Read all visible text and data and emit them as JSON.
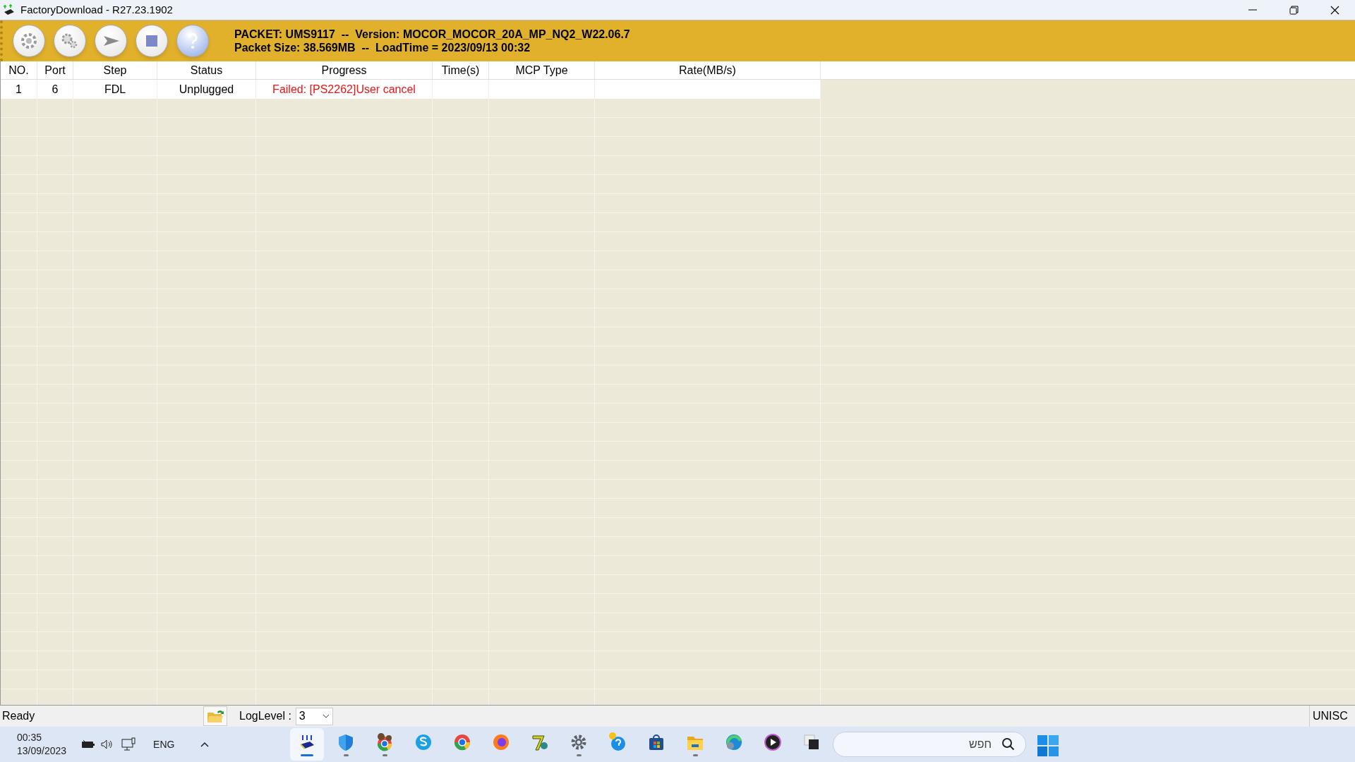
{
  "window": {
    "title": "FactoryDownload - R27.23.1902"
  },
  "toolbar": {
    "buttons": [
      {
        "kind": "settings"
      },
      {
        "kind": "advanced"
      },
      {
        "kind": "start"
      },
      {
        "kind": "stop"
      },
      {
        "kind": "help"
      }
    ],
    "packet_info": [
      "PACKET: UMS9117  --  Version: MOCOR_MOCOR_20A_MP_NQ2_W22.06.7",
      "Packet Size: 38.569MB  --  LoadTime = 2023/09/13 00:32"
    ]
  },
  "table": {
    "columns": [
      "NO.",
      "Port",
      "Step",
      "Status",
      "Progress",
      "Time(s)",
      "MCP Type",
      "Rate(MB/s)"
    ],
    "rows": [
      {
        "cells": [
          "1",
          "6",
          "FDL",
          "Unplugged",
          "Failed: [PS2262]User cancel",
          "",
          "",
          ""
        ],
        "failed": true
      }
    ]
  },
  "status_bar": {
    "text": "Ready",
    "log_level_label": "LogLevel :",
    "log_level": "3",
    "right_text": "UNISC"
  },
  "taskbar": {
    "time": "00:35",
    "date": "13/09/2023",
    "language": "ENG",
    "search_placeholder": "חפש",
    "apps": [
      {
        "kind": "download",
        "running": true,
        "active": true
      },
      {
        "kind": "shield",
        "running": true,
        "active": false
      },
      {
        "kind": "chrome-profile",
        "running": true,
        "active": false
      },
      {
        "kind": "skype",
        "running": false,
        "active": false
      },
      {
        "kind": "chrome",
        "running": false,
        "active": false
      },
      {
        "kind": "firefox",
        "running": false,
        "active": false
      },
      {
        "kind": "seven",
        "running": false,
        "active": false
      },
      {
        "kind": "gear",
        "running": true,
        "active": false
      },
      {
        "kind": "help",
        "running": false,
        "active": false
      },
      {
        "kind": "store",
        "running": false,
        "active": false
      },
      {
        "kind": "folder",
        "running": true,
        "active": false
      },
      {
        "kind": "edge",
        "running": false,
        "active": false
      },
      {
        "kind": "player",
        "running": false,
        "active": false
      },
      {
        "kind": "windows-stack",
        "running": false,
        "active": false
      }
    ]
  }
}
